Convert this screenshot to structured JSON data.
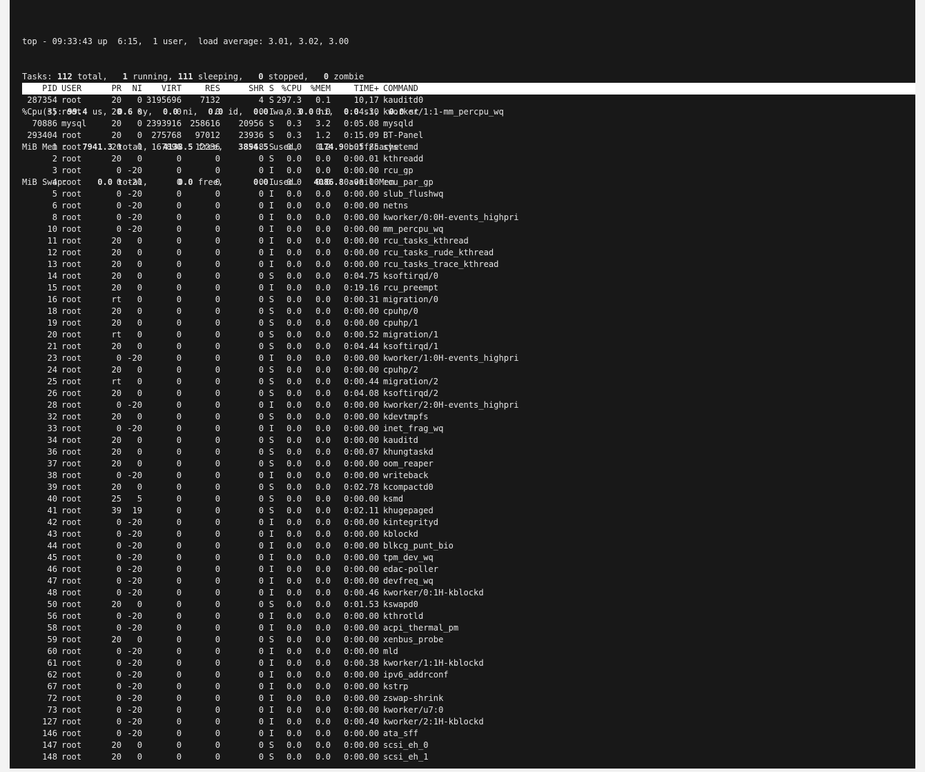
{
  "summary": {
    "line1": "top - 09:33:43 up  6:15,  1 user,  load average: 3.01, 3.02, 3.00",
    "tasks": {
      "pre": "Tasks: ",
      "total": "112",
      "t1": " total,   ",
      "running": "1",
      "t2": " running, ",
      "sleeping": "111",
      "t3": " sleeping,   ",
      "stopped": "0",
      "t4": " stopped,   ",
      "zombie": "0",
      "t5": " zombie"
    },
    "cpu": {
      "pre": "%Cpu(s): ",
      "us": "99.4",
      "t1": " us,  ",
      "sy": "0.6",
      "t2": " sy,  ",
      "ni": "0.0",
      "t3": " ni,  ",
      "id": "0.0",
      "t4": " id,  ",
      "wa": "0.0",
      "t5": " wa,  ",
      "hi": "0.0",
      "t6": " hi,  ",
      "si": "0.0",
      "t7": " si,  ",
      "st": "0.0",
      "t8": " st"
    },
    "mem": {
      "pre": "MiB Mem :   ",
      "total": "7941.3",
      "t1": " total,   ",
      "free": "4138.5",
      "t2": " free,   ",
      "used": "3854.5",
      "t3": " used,    ",
      "buff": "174.9",
      "t4": " buff/cache"
    },
    "swap": {
      "pre": "MiB Swap:      ",
      "total": "0.0",
      "t1": " total,      ",
      "free": "0.0",
      "t2": " free,      ",
      "used": "0.0",
      "t3": " used.   ",
      "avail": "4086.8",
      "t4": " avail Mem"
    }
  },
  "columns": [
    "PID",
    "USER",
    "PR",
    "NI",
    "VIRT",
    "RES",
    "SHR",
    "S",
    "%CPU",
    "%MEM",
    "TIME+",
    "COMMAND"
  ],
  "processes": [
    [
      "287354",
      "root",
      "20",
      "0",
      "3195696",
      "7132",
      "4",
      "S",
      "297.3",
      "0.1",
      "10,17",
      "kauditd0"
    ],
    [
      "35",
      "root",
      "20",
      "0",
      "0",
      "0",
      "0",
      "I",
      "0.3",
      "0.0",
      "0:04.30",
      "kworker/1:1-mm_percpu_wq"
    ],
    [
      "70886",
      "mysql",
      "20",
      "0",
      "2393916",
      "258616",
      "20956",
      "S",
      "0.3",
      "3.2",
      "0:05.08",
      "mysqld"
    ],
    [
      "293404",
      "root",
      "20",
      "0",
      "275768",
      "97012",
      "23936",
      "S",
      "0.3",
      "1.2",
      "0:15.09",
      "BT-Panel"
    ],
    [
      "1",
      "root",
      "20",
      "0",
      "167896",
      "12236",
      "8968",
      "S",
      "0.0",
      "0.2",
      "0:05.85",
      "systemd"
    ],
    [
      "2",
      "root",
      "20",
      "0",
      "0",
      "0",
      "0",
      "S",
      "0.0",
      "0.0",
      "0:00.01",
      "kthreadd"
    ],
    [
      "3",
      "root",
      "0",
      "-20",
      "0",
      "0",
      "0",
      "I",
      "0.0",
      "0.0",
      "0:00.00",
      "rcu_gp"
    ],
    [
      "4",
      "root",
      "0",
      "-20",
      "0",
      "0",
      "0",
      "I",
      "0.0",
      "0.0",
      "0:00.00",
      "rcu_par_gp"
    ],
    [
      "5",
      "root",
      "0",
      "-20",
      "0",
      "0",
      "0",
      "I",
      "0.0",
      "0.0",
      "0:00.00",
      "slub_flushwq"
    ],
    [
      "6",
      "root",
      "0",
      "-20",
      "0",
      "0",
      "0",
      "I",
      "0.0",
      "0.0",
      "0:00.00",
      "netns"
    ],
    [
      "8",
      "root",
      "0",
      "-20",
      "0",
      "0",
      "0",
      "I",
      "0.0",
      "0.0",
      "0:00.00",
      "kworker/0:0H-events_highpri"
    ],
    [
      "10",
      "root",
      "0",
      "-20",
      "0",
      "0",
      "0",
      "I",
      "0.0",
      "0.0",
      "0:00.00",
      "mm_percpu_wq"
    ],
    [
      "11",
      "root",
      "20",
      "0",
      "0",
      "0",
      "0",
      "I",
      "0.0",
      "0.0",
      "0:00.00",
      "rcu_tasks_kthread"
    ],
    [
      "12",
      "root",
      "20",
      "0",
      "0",
      "0",
      "0",
      "I",
      "0.0",
      "0.0",
      "0:00.00",
      "rcu_tasks_rude_kthread"
    ],
    [
      "13",
      "root",
      "20",
      "0",
      "0",
      "0",
      "0",
      "I",
      "0.0",
      "0.0",
      "0:00.00",
      "rcu_tasks_trace_kthread"
    ],
    [
      "14",
      "root",
      "20",
      "0",
      "0",
      "0",
      "0",
      "S",
      "0.0",
      "0.0",
      "0:04.75",
      "ksoftirqd/0"
    ],
    [
      "15",
      "root",
      "20",
      "0",
      "0",
      "0",
      "0",
      "I",
      "0.0",
      "0.0",
      "0:19.16",
      "rcu_preempt"
    ],
    [
      "16",
      "root",
      "rt",
      "0",
      "0",
      "0",
      "0",
      "S",
      "0.0",
      "0.0",
      "0:00.31",
      "migration/0"
    ],
    [
      "18",
      "root",
      "20",
      "0",
      "0",
      "0",
      "0",
      "S",
      "0.0",
      "0.0",
      "0:00.00",
      "cpuhp/0"
    ],
    [
      "19",
      "root",
      "20",
      "0",
      "0",
      "0",
      "0",
      "S",
      "0.0",
      "0.0",
      "0:00.00",
      "cpuhp/1"
    ],
    [
      "20",
      "root",
      "rt",
      "0",
      "0",
      "0",
      "0",
      "S",
      "0.0",
      "0.0",
      "0:00.52",
      "migration/1"
    ],
    [
      "21",
      "root",
      "20",
      "0",
      "0",
      "0",
      "0",
      "S",
      "0.0",
      "0.0",
      "0:04.44",
      "ksoftirqd/1"
    ],
    [
      "23",
      "root",
      "0",
      "-20",
      "0",
      "0",
      "0",
      "I",
      "0.0",
      "0.0",
      "0:00.00",
      "kworker/1:0H-events_highpri"
    ],
    [
      "24",
      "root",
      "20",
      "0",
      "0",
      "0",
      "0",
      "S",
      "0.0",
      "0.0",
      "0:00.00",
      "cpuhp/2"
    ],
    [
      "25",
      "root",
      "rt",
      "0",
      "0",
      "0",
      "0",
      "S",
      "0.0",
      "0.0",
      "0:00.44",
      "migration/2"
    ],
    [
      "26",
      "root",
      "20",
      "0",
      "0",
      "0",
      "0",
      "S",
      "0.0",
      "0.0",
      "0:04.08",
      "ksoftirqd/2"
    ],
    [
      "28",
      "root",
      "0",
      "-20",
      "0",
      "0",
      "0",
      "I",
      "0.0",
      "0.0",
      "0:00.00",
      "kworker/2:0H-events_highpri"
    ],
    [
      "32",
      "root",
      "20",
      "0",
      "0",
      "0",
      "0",
      "S",
      "0.0",
      "0.0",
      "0:00.00",
      "kdevtmpfs"
    ],
    [
      "33",
      "root",
      "0",
      "-20",
      "0",
      "0",
      "0",
      "I",
      "0.0",
      "0.0",
      "0:00.00",
      "inet_frag_wq"
    ],
    [
      "34",
      "root",
      "20",
      "0",
      "0",
      "0",
      "0",
      "S",
      "0.0",
      "0.0",
      "0:00.00",
      "kauditd"
    ],
    [
      "36",
      "root",
      "20",
      "0",
      "0",
      "0",
      "0",
      "S",
      "0.0",
      "0.0",
      "0:00.07",
      "khungtaskd"
    ],
    [
      "37",
      "root",
      "20",
      "0",
      "0",
      "0",
      "0",
      "S",
      "0.0",
      "0.0",
      "0:00.00",
      "oom_reaper"
    ],
    [
      "38",
      "root",
      "0",
      "-20",
      "0",
      "0",
      "0",
      "I",
      "0.0",
      "0.0",
      "0:00.00",
      "writeback"
    ],
    [
      "39",
      "root",
      "20",
      "0",
      "0",
      "0",
      "0",
      "S",
      "0.0",
      "0.0",
      "0:02.78",
      "kcompactd0"
    ],
    [
      "40",
      "root",
      "25",
      "5",
      "0",
      "0",
      "0",
      "S",
      "0.0",
      "0.0",
      "0:00.00",
      "ksmd"
    ],
    [
      "41",
      "root",
      "39",
      "19",
      "0",
      "0",
      "0",
      "S",
      "0.0",
      "0.0",
      "0:02.11",
      "khugepaged"
    ],
    [
      "42",
      "root",
      "0",
      "-20",
      "0",
      "0",
      "0",
      "I",
      "0.0",
      "0.0",
      "0:00.00",
      "kintegrityd"
    ],
    [
      "43",
      "root",
      "0",
      "-20",
      "0",
      "0",
      "0",
      "I",
      "0.0",
      "0.0",
      "0:00.00",
      "kblockd"
    ],
    [
      "44",
      "root",
      "0",
      "-20",
      "0",
      "0",
      "0",
      "I",
      "0.0",
      "0.0",
      "0:00.00",
      "blkcg_punt_bio"
    ],
    [
      "45",
      "root",
      "0",
      "-20",
      "0",
      "0",
      "0",
      "I",
      "0.0",
      "0.0",
      "0:00.00",
      "tpm_dev_wq"
    ],
    [
      "46",
      "root",
      "0",
      "-20",
      "0",
      "0",
      "0",
      "I",
      "0.0",
      "0.0",
      "0:00.00",
      "edac-poller"
    ],
    [
      "47",
      "root",
      "0",
      "-20",
      "0",
      "0",
      "0",
      "I",
      "0.0",
      "0.0",
      "0:00.00",
      "devfreq_wq"
    ],
    [
      "48",
      "root",
      "0",
      "-20",
      "0",
      "0",
      "0",
      "I",
      "0.0",
      "0.0",
      "0:00.46",
      "kworker/0:1H-kblockd"
    ],
    [
      "50",
      "root",
      "20",
      "0",
      "0",
      "0",
      "0",
      "S",
      "0.0",
      "0.0",
      "0:01.53",
      "kswapd0"
    ],
    [
      "56",
      "root",
      "0",
      "-20",
      "0",
      "0",
      "0",
      "I",
      "0.0",
      "0.0",
      "0:00.00",
      "kthrotld"
    ],
    [
      "58",
      "root",
      "0",
      "-20",
      "0",
      "0",
      "0",
      "I",
      "0.0",
      "0.0",
      "0:00.00",
      "acpi_thermal_pm"
    ],
    [
      "59",
      "root",
      "20",
      "0",
      "0",
      "0",
      "0",
      "S",
      "0.0",
      "0.0",
      "0:00.00",
      "xenbus_probe"
    ],
    [
      "60",
      "root",
      "0",
      "-20",
      "0",
      "0",
      "0",
      "I",
      "0.0",
      "0.0",
      "0:00.00",
      "mld"
    ],
    [
      "61",
      "root",
      "0",
      "-20",
      "0",
      "0",
      "0",
      "I",
      "0.0",
      "0.0",
      "0:00.38",
      "kworker/1:1H-kblockd"
    ],
    [
      "62",
      "root",
      "0",
      "-20",
      "0",
      "0",
      "0",
      "I",
      "0.0",
      "0.0",
      "0:00.00",
      "ipv6_addrconf"
    ],
    [
      "67",
      "root",
      "0",
      "-20",
      "0",
      "0",
      "0",
      "I",
      "0.0",
      "0.0",
      "0:00.00",
      "kstrp"
    ],
    [
      "72",
      "root",
      "0",
      "-20",
      "0",
      "0",
      "0",
      "I",
      "0.0",
      "0.0",
      "0:00.00",
      "zswap-shrink"
    ],
    [
      "73",
      "root",
      "0",
      "-20",
      "0",
      "0",
      "0",
      "I",
      "0.0",
      "0.0",
      "0:00.00",
      "kworker/u7:0"
    ],
    [
      "127",
      "root",
      "0",
      "-20",
      "0",
      "0",
      "0",
      "I",
      "0.0",
      "0.0",
      "0:00.40",
      "kworker/2:1H-kblockd"
    ],
    [
      "146",
      "root",
      "0",
      "-20",
      "0",
      "0",
      "0",
      "I",
      "0.0",
      "0.0",
      "0:00.00",
      "ata_sff"
    ],
    [
      "147",
      "root",
      "20",
      "0",
      "0",
      "0",
      "0",
      "S",
      "0.0",
      "0.0",
      "0:00.00",
      "scsi_eh_0"
    ],
    [
      "148",
      "root",
      "20",
      "0",
      "0",
      "0",
      "0",
      "S",
      "0.0",
      "0.0",
      "0:00.00",
      "scsi_eh_1"
    ]
  ]
}
